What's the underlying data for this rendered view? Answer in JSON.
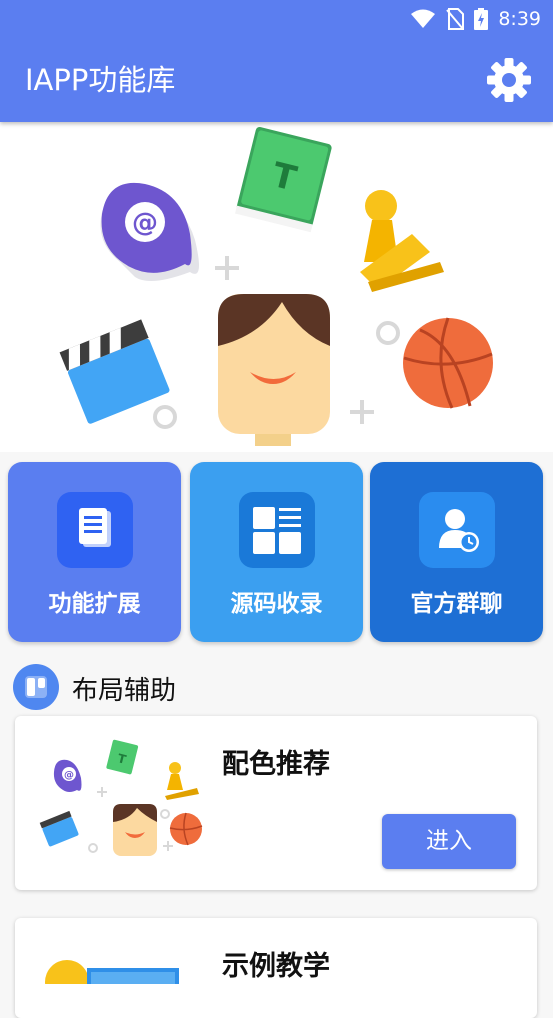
{
  "status": {
    "time": "8:39",
    "icons": [
      "wifi-icon",
      "no-sim-icon",
      "battery-charging-icon"
    ]
  },
  "appbar": {
    "title": "IAPP功能库",
    "settings_icon": "gear-icon"
  },
  "colors": {
    "primary": "#5b7ef0",
    "tile_extend": "#5a7ef0",
    "tile_source": "#3b9ff0",
    "tile_group": "#1e6fd4"
  },
  "tiles": [
    {
      "label": "功能扩展",
      "icon": "document-icon"
    },
    {
      "label": "源码收录",
      "icon": "layout-grid-icon"
    },
    {
      "label": "官方群聊",
      "icon": "user-clock-icon"
    }
  ],
  "section": {
    "title": "布局辅助",
    "icon": "layout-icon"
  },
  "cards": [
    {
      "title": "配色推荐",
      "button": "进入"
    },
    {
      "title": "示例教学"
    }
  ]
}
